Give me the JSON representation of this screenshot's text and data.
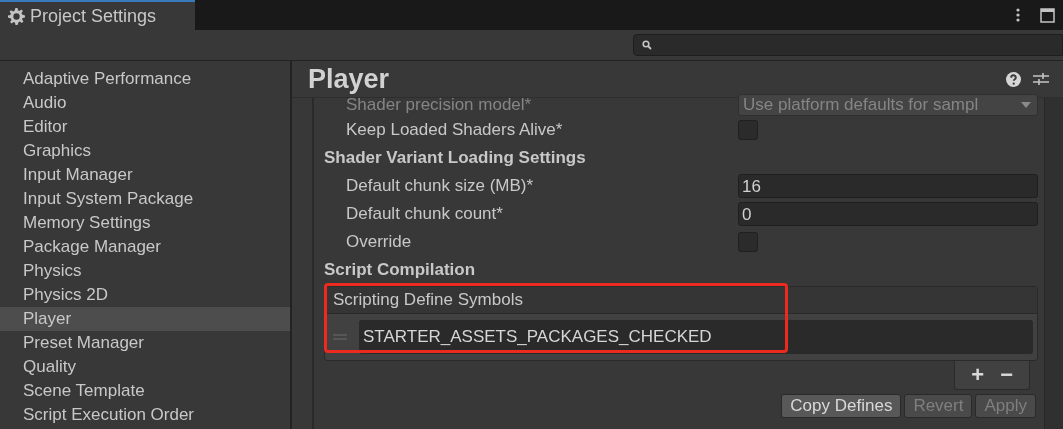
{
  "window": {
    "title": "Project Settings"
  },
  "sidebar": {
    "items": [
      {
        "label": "Adaptive Performance",
        "selected": false
      },
      {
        "label": "Audio",
        "selected": false
      },
      {
        "label": "Editor",
        "selected": false
      },
      {
        "label": "Graphics",
        "selected": false
      },
      {
        "label": "Input Manager",
        "selected": false
      },
      {
        "label": "Input System Package",
        "selected": false
      },
      {
        "label": "Memory Settings",
        "selected": false
      },
      {
        "label": "Package Manager",
        "selected": false
      },
      {
        "label": "Physics",
        "selected": false
      },
      {
        "label": "Physics 2D",
        "selected": false
      },
      {
        "label": "Player",
        "selected": true
      },
      {
        "label": "Preset Manager",
        "selected": false
      },
      {
        "label": "Quality",
        "selected": false
      },
      {
        "label": "Scene Template",
        "selected": false
      },
      {
        "label": "Script Execution Order",
        "selected": false
      }
    ]
  },
  "page": {
    "title": "Player",
    "rows": [
      {
        "kind": "dropdown",
        "label": "Shader precision model*",
        "value": "Use platform defaults for sampl",
        "disabled": true
      },
      {
        "kind": "checkbox",
        "label": "Keep Loaded Shaders Alive*",
        "checked": false
      },
      {
        "kind": "heading",
        "label": "Shader Variant Loading Settings"
      },
      {
        "kind": "number",
        "label": "Default chunk size (MB)*",
        "value": "16"
      },
      {
        "kind": "number",
        "label": "Default chunk count*",
        "value": "0"
      },
      {
        "kind": "checkbox",
        "label": "Override",
        "checked": false
      },
      {
        "kind": "heading",
        "label": "Script Compilation"
      }
    ],
    "define_symbols": {
      "title": "Scripting Define Symbols",
      "highlighted": true,
      "items": [
        "STARTER_ASSETS_PACKAGES_CHECKED"
      ],
      "add": "+",
      "remove": "−"
    },
    "buttons": [
      {
        "label": "Copy Defines",
        "disabled": false
      },
      {
        "label": "Revert",
        "disabled": true
      },
      {
        "label": "Apply",
        "disabled": true
      }
    ]
  }
}
